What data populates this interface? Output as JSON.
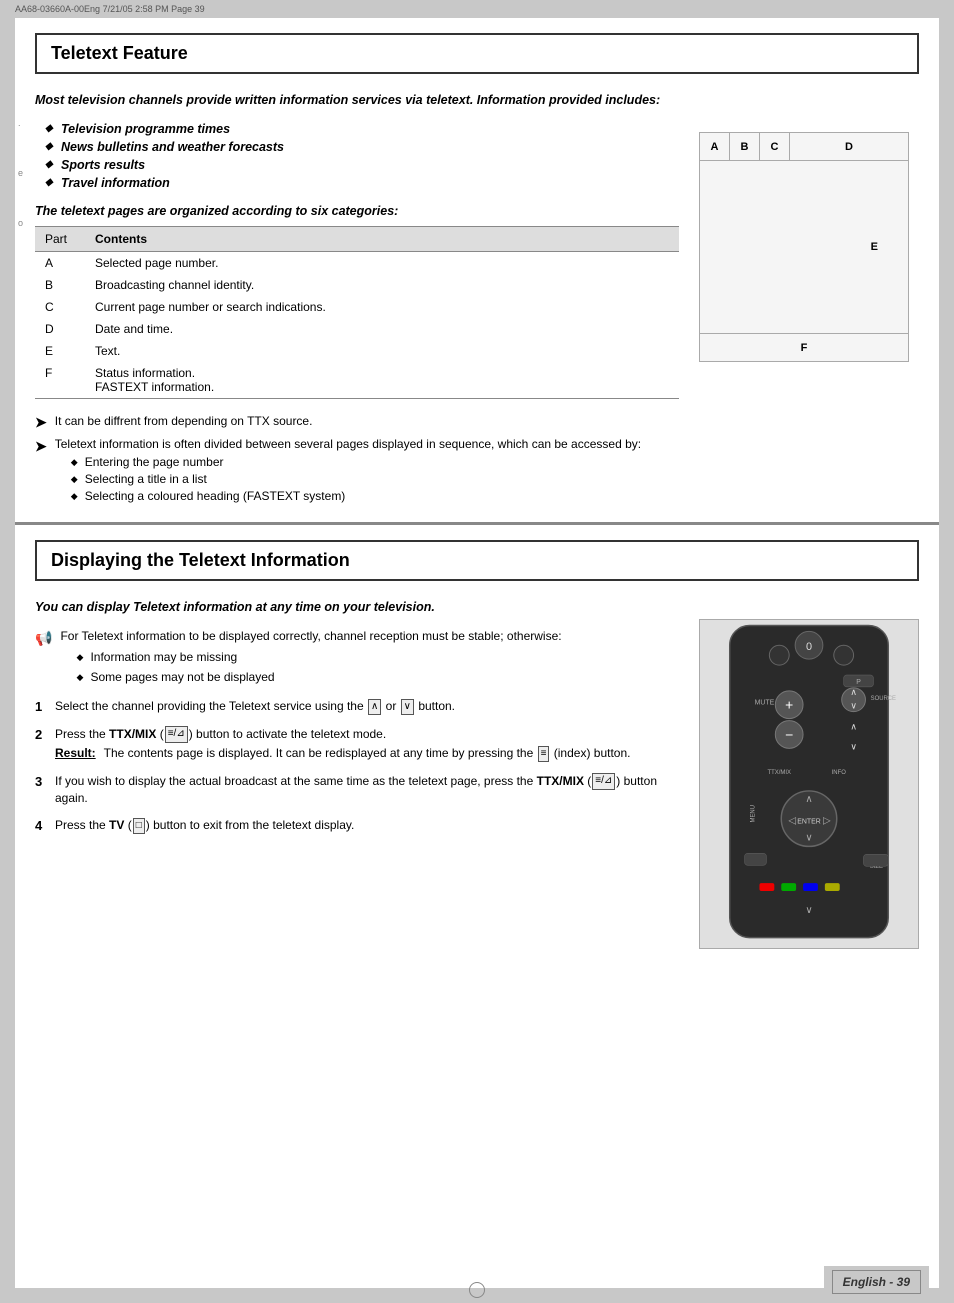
{
  "header": {
    "text": "AA68-03660A-00Eng   7/21/05   2:58 PM   Page 39"
  },
  "section1": {
    "title": "Teletext Feature",
    "intro": "Most television channels provide written information services via teletext. Information provided includes:",
    "bullets": [
      "Television programme times",
      "News bulletins and weather forecasts",
      "Sports results",
      "Travel information"
    ],
    "subheading": "The teletext pages are organized according to six categories:",
    "table": {
      "col1": "Part",
      "col2": "Contents",
      "rows": [
        {
          "part": "A",
          "contents": "Selected page number."
        },
        {
          "part": "B",
          "contents": "Broadcasting channel identity."
        },
        {
          "part": "C",
          "contents": "Current page number or search indications."
        },
        {
          "part": "D",
          "contents": "Date and time."
        },
        {
          "part": "E",
          "contents": "Text."
        },
        {
          "part": "F",
          "contents": "Status information.\nFASTEXT information."
        }
      ]
    },
    "notes": [
      "It can be  diffrent from depending on TTX source.",
      "Teletext information is often divided between several pages displayed in sequence, which can be accessed by:"
    ],
    "sub_bullets": [
      "Entering the page number",
      "Selecting a title in a list",
      "Selecting a coloured heading (FASTEXT system)"
    ],
    "diagram_labels": {
      "a": "A",
      "b": "B",
      "c": "C",
      "d": "D",
      "e": "E",
      "f": "F"
    }
  },
  "section2": {
    "title": "Displaying the Teletext Information",
    "intro": "You can display Teletext information at any time on your television.",
    "note": "For Teletext information to be displayed correctly, channel reception must be stable; otherwise:",
    "note_bullets": [
      "Information may be missing",
      "Some pages may not be displayed"
    ],
    "steps": [
      {
        "num": "1",
        "text": "Select the channel providing the Teletext service using the",
        "text2": "or",
        "text3": "button."
      },
      {
        "num": "2",
        "text": "Press the TTX/MIX (",
        "text_icon": "≡/⊿",
        "text2": ") button to activate the teletext mode.",
        "result_label": "Result:",
        "result_text": "The contents page is displayed. It can be redisplayed at any time by pressing the",
        "result_icon": "≡",
        "result_text2": "(index) button."
      },
      {
        "num": "3",
        "text": "If you wish to display the actual broadcast at the same time as the teletext page, press the TTX/MIX (",
        "text_icon": "≡/⊿",
        "text2": ") button again."
      },
      {
        "num": "4",
        "text": "Press the TV (",
        "text_icon": "□",
        "text2": ") button to exit from the teletext display."
      }
    ]
  },
  "footer": {
    "text": "English - 39",
    "lang": "English",
    "page": "39"
  }
}
